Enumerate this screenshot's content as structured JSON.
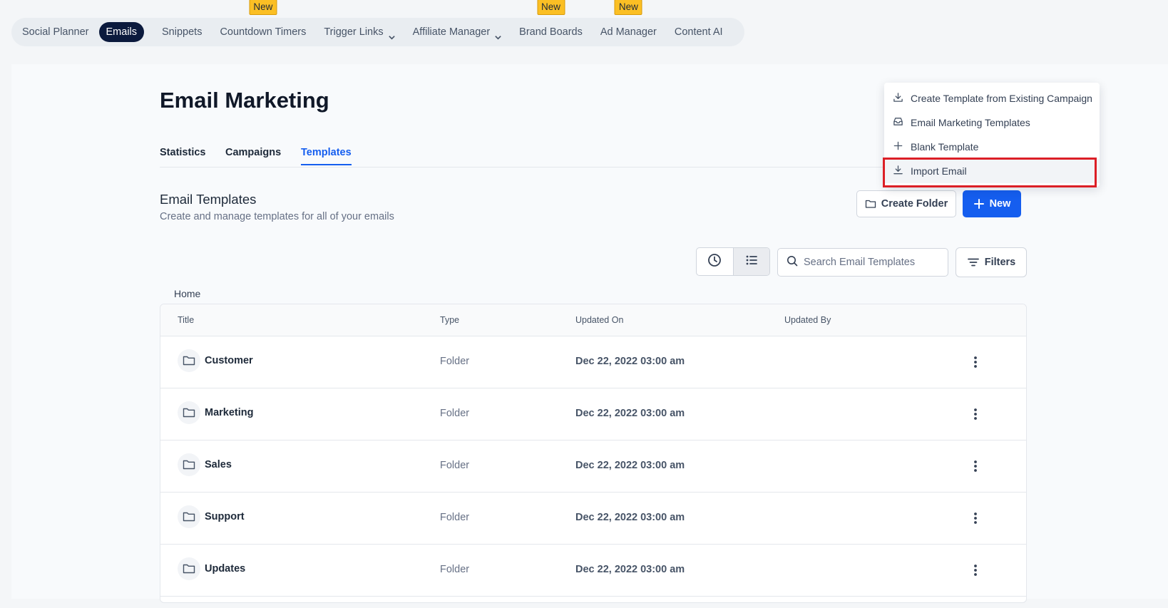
{
  "topnav": {
    "items": [
      {
        "label": "Social Planner",
        "active": false,
        "dropdown": false,
        "badge": ""
      },
      {
        "label": "Emails",
        "active": true,
        "dropdown": false,
        "badge": ""
      },
      {
        "label": "Snippets",
        "active": false,
        "dropdown": false,
        "badge": ""
      },
      {
        "label": "Countdown Timers",
        "active": false,
        "dropdown": false,
        "badge": "New"
      },
      {
        "label": "Trigger Links",
        "active": false,
        "dropdown": true,
        "badge": ""
      },
      {
        "label": "Affiliate Manager",
        "active": false,
        "dropdown": true,
        "badge": ""
      },
      {
        "label": "Brand Boards",
        "active": false,
        "dropdown": false,
        "badge": "New"
      },
      {
        "label": "Ad Manager",
        "active": false,
        "dropdown": false,
        "badge": "New"
      },
      {
        "label": "Content AI",
        "active": false,
        "dropdown": false,
        "badge": ""
      }
    ]
  },
  "page": {
    "title": "Email Marketing",
    "tabs": [
      "Statistics",
      "Campaigns",
      "Templates"
    ],
    "active_tab": "Templates"
  },
  "section": {
    "title": "Email Templates",
    "subtitle": "Create and manage templates for all of your emails",
    "create_folder_label": "Create Folder",
    "new_label": "New"
  },
  "toolbar": {
    "search_placeholder": "Search Email Templates",
    "filters_label": "Filters"
  },
  "breadcrumb": "Home",
  "table": {
    "columns": [
      "Title",
      "Type",
      "Updated On",
      "Updated By"
    ],
    "rows": [
      {
        "title": "Customer",
        "type": "Folder",
        "updated_on": "Dec 22, 2022 03:00 am",
        "updated_by": ""
      },
      {
        "title": "Marketing",
        "type": "Folder",
        "updated_on": "Dec 22, 2022 03:00 am",
        "updated_by": ""
      },
      {
        "title": "Sales",
        "type": "Folder",
        "updated_on": "Dec 22, 2022 03:00 am",
        "updated_by": ""
      },
      {
        "title": "Support",
        "type": "Folder",
        "updated_on": "Dec 22, 2022 03:00 am",
        "updated_by": ""
      },
      {
        "title": "Updates",
        "type": "Folder",
        "updated_on": "Dec 22, 2022 03:00 am",
        "updated_by": ""
      }
    ]
  },
  "new_menu": {
    "items": [
      {
        "label": "Create Template from Existing Campaign",
        "icon": "download-icon"
      },
      {
        "label": "Email Marketing Templates",
        "icon": "inbox-icon"
      },
      {
        "label": "Blank Template",
        "icon": "plus-icon"
      },
      {
        "label": "Import Email",
        "icon": "download-icon"
      }
    ],
    "highlighted_index": 3
  },
  "colors": {
    "primary": "#155eef",
    "nav_active": "#0b1a3d",
    "badge": "#fbbf24",
    "highlight_border": "#dc1f26"
  }
}
